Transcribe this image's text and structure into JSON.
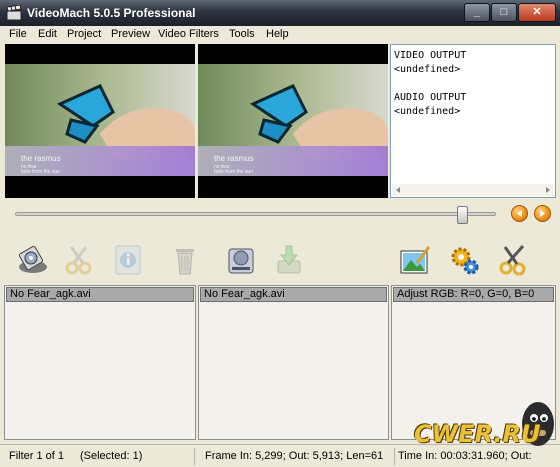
{
  "window": {
    "title": "VideoMach 5.0.5 Professional",
    "app_icon": "clapperboard-icon",
    "controls": [
      {
        "name": "minimize-button",
        "label": "_",
        "icon": "minimize-icon"
      },
      {
        "name": "maximize-button",
        "label": "□",
        "icon": "maximize-icon"
      },
      {
        "name": "close-button",
        "label": "✕",
        "icon": "close-icon"
      }
    ]
  },
  "menu": [
    "File",
    "Edit",
    "Project",
    "Preview",
    "Video Filters",
    "Tools",
    "Help"
  ],
  "preview": {
    "input_caption": {
      "line1": "the rasmus",
      "line2": "no fear",
      "line3": "fade from the sun"
    },
    "output_caption": {
      "line1": "the rasmus",
      "line2": "no fear",
      "line3": "fade from the sun"
    }
  },
  "output_info": {
    "text": "VIDEO OUTPUT\n<undefined>\n\nAUDIO OUTPUT\n<undefined>"
  },
  "timeline": {
    "position": 0.93,
    "prev_icon": "arrow-left-icon",
    "next_icon": "arrow-right-icon"
  },
  "toolbar": {
    "left": [
      {
        "name": "open-media-button",
        "icon": "disk-open-icon",
        "enabled": true
      },
      {
        "name": "cut-button",
        "icon": "scissors-icon",
        "enabled": false
      },
      {
        "name": "info-button",
        "icon": "info-icon",
        "enabled": false
      },
      {
        "name": "delete-button",
        "icon": "trash-icon",
        "enabled": false
      },
      {
        "name": "save-output-button",
        "icon": "hard-disk-icon",
        "enabled": true
      },
      {
        "name": "export-button",
        "icon": "export-icon",
        "enabled": false
      }
    ],
    "right": [
      {
        "name": "edit-image-button",
        "icon": "picture-edit-icon",
        "enabled": true
      },
      {
        "name": "settings-button",
        "icon": "gears-icon",
        "enabled": true
      },
      {
        "name": "tools-button",
        "icon": "scissors-icon",
        "enabled": true
      }
    ]
  },
  "panels": {
    "input_list": {
      "items": [
        "No Fear_agk.avi"
      ]
    },
    "output_list": {
      "items": [
        "No Fear_agk.avi"
      ]
    },
    "filters_list": {
      "items": [
        "Adjust RGB:  R=0, G=0, B=0"
      ]
    }
  },
  "status": {
    "filter": "Filter 1 of 1",
    "selected": "(Selected: 1)",
    "frames": "Frame In: 5,299;  Out: 5,913;  Len=61",
    "time": "Time In: 00:03:31.960;  Out:"
  },
  "watermark": {
    "text": "CWER.RU"
  }
}
